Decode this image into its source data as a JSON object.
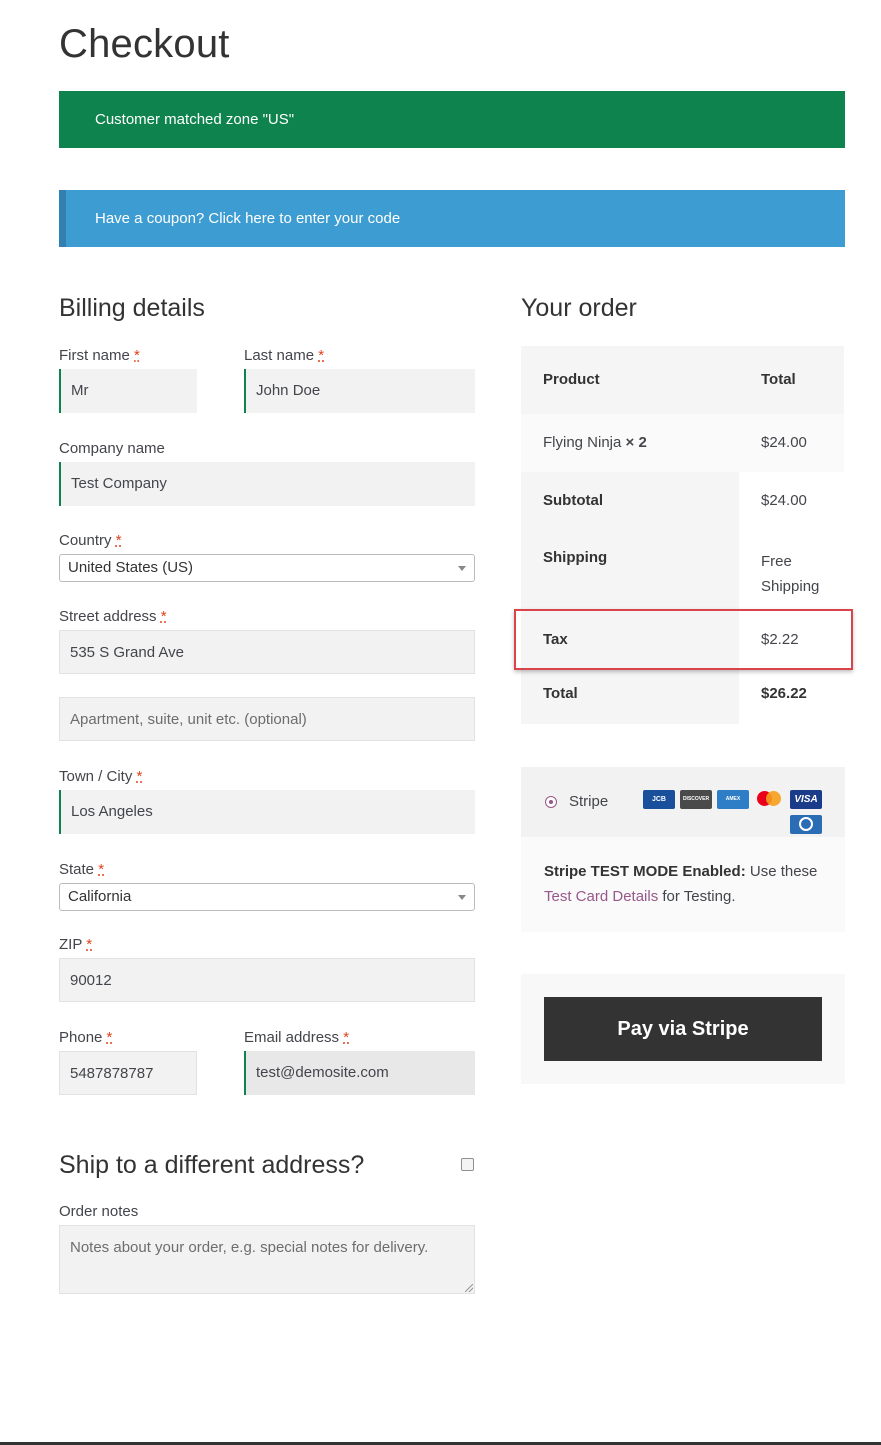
{
  "page": {
    "title": "Checkout"
  },
  "notices": {
    "zone_match": "Customer matched zone \"US\"",
    "coupon": "Have a coupon? Click here to enter your code"
  },
  "billing": {
    "title": "Billing details",
    "required_mark": "*",
    "first_name": {
      "label": "First name",
      "value": "Mr"
    },
    "last_name": {
      "label": "Last name",
      "value": "John Doe"
    },
    "company": {
      "label": "Company name",
      "value": "Test Company"
    },
    "country": {
      "label": "Country",
      "value": "United States (US)"
    },
    "street": {
      "label": "Street address",
      "value": "535 S Grand Ave",
      "placeholder2": "Apartment, suite, unit etc. (optional)"
    },
    "city": {
      "label": "Town / City",
      "value": "Los Angeles"
    },
    "state": {
      "label": "State",
      "value": "California"
    },
    "zip": {
      "label": "ZIP",
      "value": "90012"
    },
    "phone": {
      "label": "Phone",
      "value": "5487878787"
    },
    "email": {
      "label": "Email address",
      "value": "test@demosite.com"
    }
  },
  "shipping": {
    "title": "Ship to a different address?",
    "checked": false
  },
  "notes": {
    "label": "Order notes",
    "placeholder": "Notes about your order, e.g. special notes for delivery."
  },
  "order": {
    "title": "Your order",
    "header": {
      "product": "Product",
      "total": "Total"
    },
    "item": {
      "name": "Flying Ninja",
      "qty": "× 2",
      "total": "$24.00"
    },
    "subtotal": {
      "label": "Subtotal",
      "value": "$24.00"
    },
    "shipping": {
      "label": "Shipping",
      "value_line1": "Free",
      "value_line2": "Shipping"
    },
    "tax": {
      "label": "Tax",
      "value": "$2.22"
    },
    "total": {
      "label": "Total",
      "value": "$26.22"
    }
  },
  "payment": {
    "method": "Stripe",
    "cards": [
      "JCB",
      "DISCOVER",
      "AMEX",
      "MASTERCARD",
      "VISA",
      "DINERS"
    ],
    "note_bold": "Stripe TEST MODE Enabled:",
    "note_text": " Use these",
    "note_link": "Test Card Details",
    "note_tail": " for Testing.",
    "button": "Pay via Stripe"
  },
  "colors": {
    "success": "#0f834d",
    "info": "#3d9cd2",
    "highlight": "#d9444a",
    "link": "#96588a"
  }
}
